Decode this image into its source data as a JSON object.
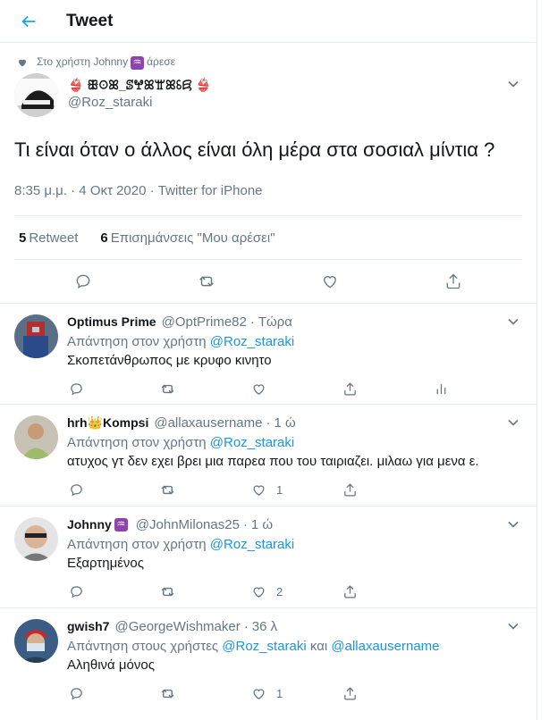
{
  "header": {
    "title": "Tweet",
    "back_icon": "arrow-left-icon"
  },
  "colors": {
    "accent": "#1da1f2",
    "link": "#1b95e0",
    "secondary": "#657786",
    "border": "#e6ecf0"
  },
  "main_tweet": {
    "social_context": {
      "prefix": "Στο χρήστη Johnny",
      "suffix": "άρεσε",
      "emoji": "♒"
    },
    "author": {
      "name_deco": "👙",
      "name": "ꕥꖴꕤ_ꕷꖡꕤꖁꕤꗏꗛ",
      "handle": "@Roz_staraki"
    },
    "text": "Τι είναι όταν ο άλλος είναι όλη μέρα στα σοσιαλ μίντια ?",
    "timestamp": "8:35 μ.μ. · 4 Οκτ 2020 · Twitter for iPhone",
    "stats": {
      "retweets_count": "5",
      "retweets_label": "Retweet",
      "likes_count": "6",
      "likes_label": "Επισημάνσεις \"Μου αρέσει\""
    }
  },
  "replies": [
    {
      "name": "Optimus Prime",
      "name_emoji": "",
      "handle": "@OptPrime82",
      "time": "Τώρα",
      "to_prefix": "Απάντηση στον χρήστη",
      "to_mentions": "@Roz_staraki",
      "to_join": "",
      "to_mentions2": "",
      "text": "Σκοπετάνθρωπος με κρυφο κινητο",
      "like_count": "",
      "has_analytics": true
    },
    {
      "name": "hrh",
      "name_emoji": "👑",
      "name_suffix": "Kompsi",
      "handle": "@allaxausername",
      "time": "1 ώ",
      "to_prefix": "Απάντηση στον χρήστη",
      "to_mentions": "@Roz_staraki",
      "to_join": "",
      "to_mentions2": "",
      "text": "ατυχος γτ δεν εχει βρει μια παρεα που του ταιριαζει. μιλαω για μενα ε.",
      "like_count": "1",
      "has_analytics": false
    },
    {
      "name": "Johnny",
      "name_emoji": "♒",
      "handle": "@JohnMilonas25",
      "time": "1 ώ",
      "to_prefix": "Απάντηση στον χρήστη",
      "to_mentions": "@Roz_staraki",
      "to_join": "",
      "to_mentions2": "",
      "text": "Εξαρτημένος",
      "like_count": "2",
      "has_analytics": false
    },
    {
      "name": "gwish7",
      "name_emoji": "",
      "handle": "@GeorgeWishmaker",
      "time": "36 λ",
      "to_prefix": "Απάντηση στους χρήστες",
      "to_mentions": "@Roz_staraki",
      "to_join": "και",
      "to_mentions2": "@allaxausername",
      "text": "Αληθινά μόνος",
      "like_count": "1",
      "has_analytics": false
    }
  ]
}
